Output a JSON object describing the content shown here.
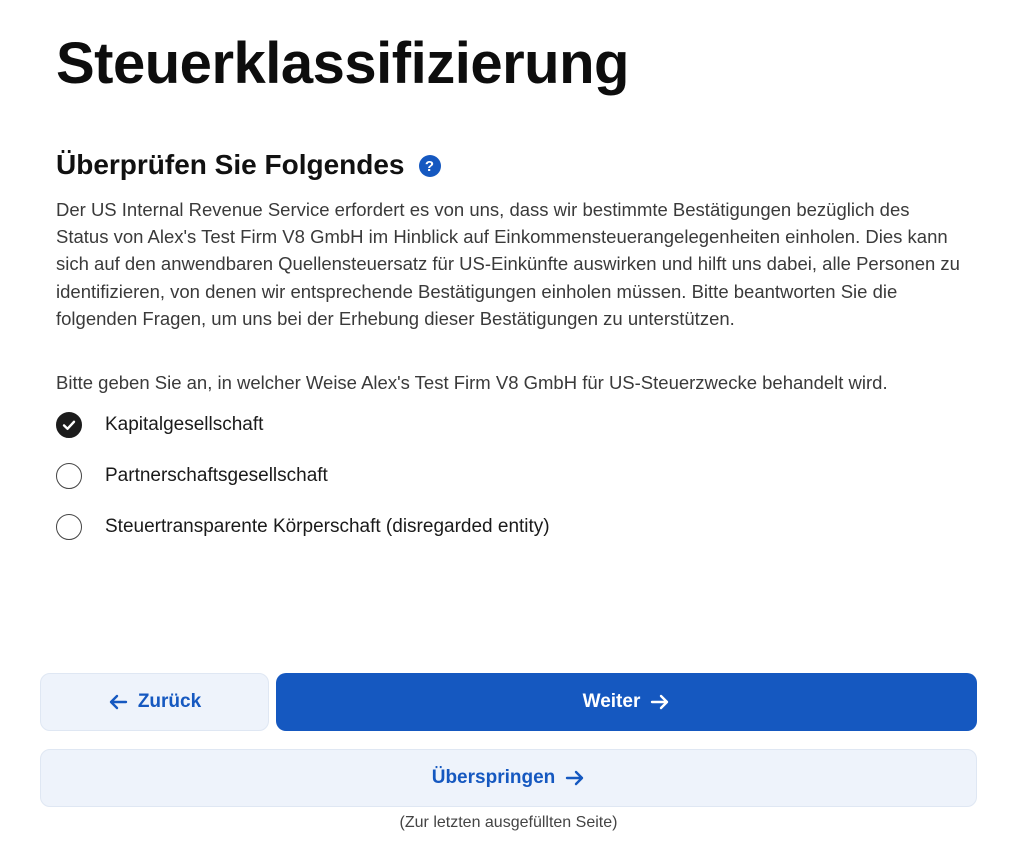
{
  "page": {
    "title": "Steuerklassifizierung"
  },
  "section": {
    "heading": "Überprüfen Sie Folgendes",
    "help_icon_label": "?",
    "intro": "Der US Internal Revenue Service erfordert es von uns, dass wir bestimmte Bestätigungen bezüglich des Status von Alex's Test Firm V8 GmbH im Hinblick auf Einkommensteuerangelegenheiten einholen. Dies kann sich auf den anwendbaren Quellensteuersatz für US-Einkünfte auswirken und hilft uns dabei, alle Personen zu identifizieren, von denen wir entsprechende Bestätigungen einholen müssen. Bitte beantworten Sie die folgenden Fragen, um uns bei der Erhebung dieser Bestätigungen zu unterstützen.",
    "question": "Bitte geben Sie an, in welcher Weise Alex's Test Firm V8 GmbH für US-Steuerzwecke behandelt wird."
  },
  "options": [
    {
      "label": "Kapitalgesellschaft",
      "selected": true
    },
    {
      "label": "Partnerschaftsgesellschaft",
      "selected": false
    },
    {
      "label": "Steuertransparente Körperschaft (disregarded entity)",
      "selected": false
    }
  ],
  "buttons": {
    "back_label": "Zurück",
    "next_label": "Weiter",
    "skip_label": "Überspringen",
    "skip_note": "(Zur letzten ausgefüllten Seite)"
  },
  "icons": {
    "help": "question-circle-icon",
    "back": "arrow-left-icon",
    "next": "arrow-right-icon",
    "skip": "arrow-right-icon",
    "selected": "check-icon"
  },
  "colors": {
    "primary": "#1558c0",
    "secondary_bg": "#eef3fb",
    "text": "#111111",
    "muted_text": "#3a3a3a"
  }
}
